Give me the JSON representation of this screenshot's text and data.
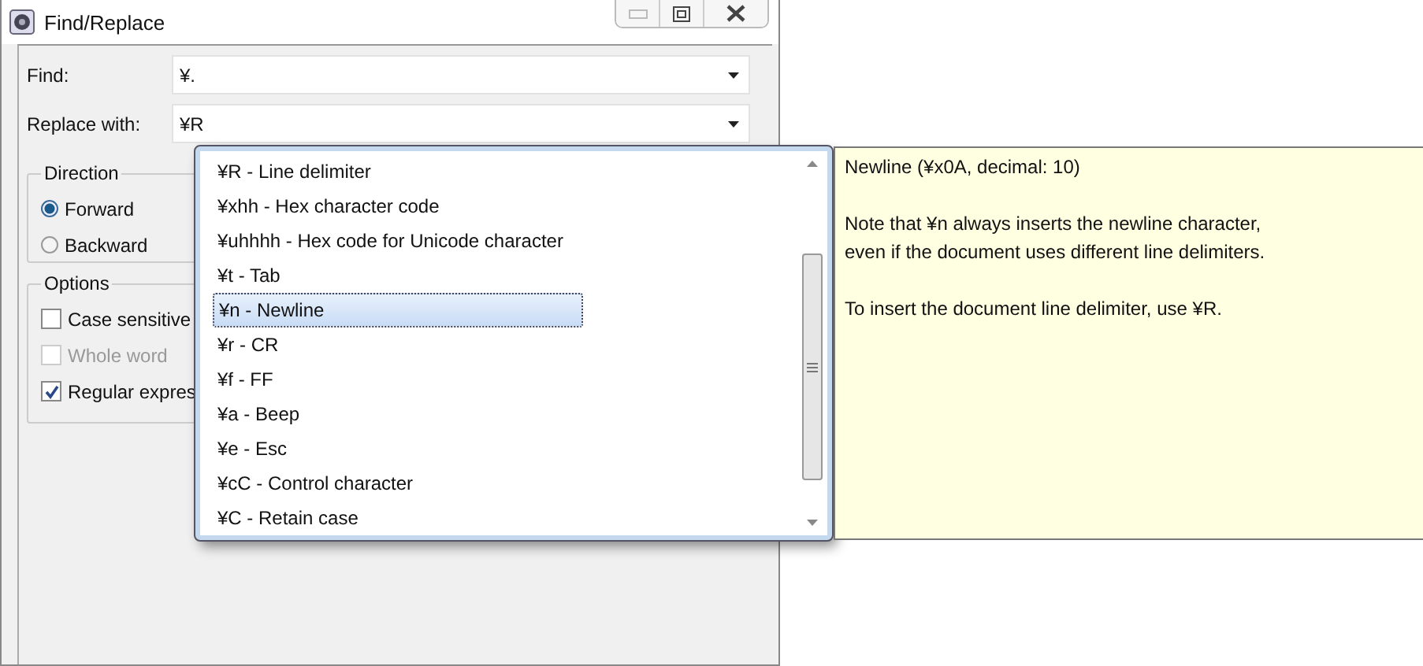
{
  "window": {
    "title": "Find/Replace"
  },
  "fields": [
    {
      "label": "Find:",
      "value": "¥."
    },
    {
      "label": "Replace with:",
      "value": "¥R"
    }
  ],
  "direction": {
    "title": "Direction",
    "options": [
      {
        "label": "Forward",
        "selected": true
      },
      {
        "label": "Backward",
        "selected": false
      }
    ]
  },
  "options": {
    "title": "Options",
    "items": [
      {
        "label": "Case sensitive",
        "checked": false,
        "disabled": false
      },
      {
        "label": "Whole word",
        "checked": false,
        "disabled": true
      },
      {
        "label": "Regular expres",
        "checked": true,
        "disabled": false
      }
    ]
  },
  "proposals": {
    "items": [
      {
        "text": "¥R - Line delimiter",
        "selected": false
      },
      {
        "text": "¥xhh - Hex character code",
        "selected": false
      },
      {
        "text": "¥uhhhh - Hex code for Unicode character",
        "selected": false
      },
      {
        "text": "¥t - Tab",
        "selected": false
      },
      {
        "text": "¥n - Newline",
        "selected": true
      },
      {
        "text": "¥r - CR",
        "selected": false
      },
      {
        "text": "¥f - FF",
        "selected": false
      },
      {
        "text": "¥a - Beep",
        "selected": false
      },
      {
        "text": "¥e - Esc",
        "selected": false
      },
      {
        "text": "¥cC - Control character",
        "selected": false
      },
      {
        "text": "¥C - Retain case",
        "selected": false
      }
    ]
  },
  "tooltip": {
    "paragraphs": [
      "Newline (¥x0A, decimal: 10)",
      "Note that ¥n always inserts the newline character,\neven if the document uses different line delimiters.",
      "To insert the document line delimiter, use ¥R."
    ]
  }
}
